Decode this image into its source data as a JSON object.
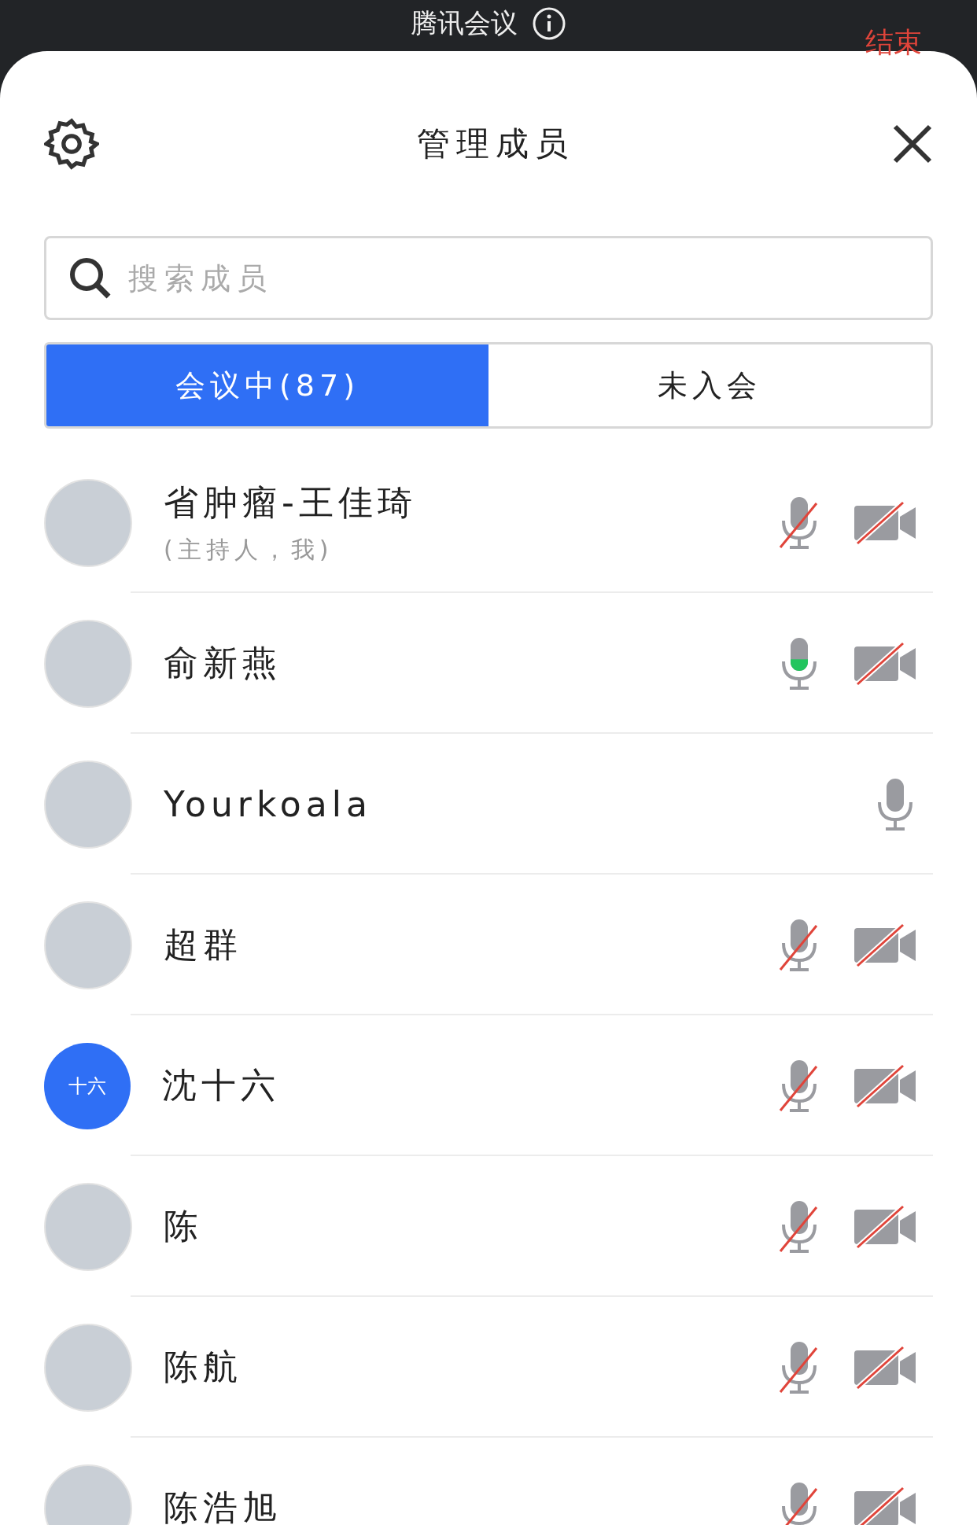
{
  "status_bar": {
    "title": "腾讯会议",
    "end_button": "结束"
  },
  "header": {
    "title": "管理成员"
  },
  "search": {
    "placeholder": "搜索成员"
  },
  "tabs": [
    {
      "label": "会议中(87)",
      "selected": true
    },
    {
      "label": "未入会",
      "selected": false
    }
  ],
  "members": [
    {
      "name": "省肿瘤-王佳琦",
      "note": "(主持人，我)",
      "mic_muted": true,
      "camera": true
    },
    {
      "name": "俞新燕",
      "mic_muted": false,
      "level": 0.35,
      "camera": true
    },
    {
      "name": "Yourkoala",
      "mic_muted": false,
      "camera": false
    },
    {
      "name": "超群",
      "mic_muted": true,
      "camera": true
    },
    {
      "name": "沈十六",
      "initials": "十六",
      "mic_muted": true,
      "camera": true
    },
    {
      "name": "陈",
      "mic_muted": true,
      "camera": true
    },
    {
      "name": "陈航",
      "mic_muted": true,
      "camera": true
    },
    {
      "name": "陈浩旭",
      "mic_muted": true,
      "camera": true
    }
  ]
}
